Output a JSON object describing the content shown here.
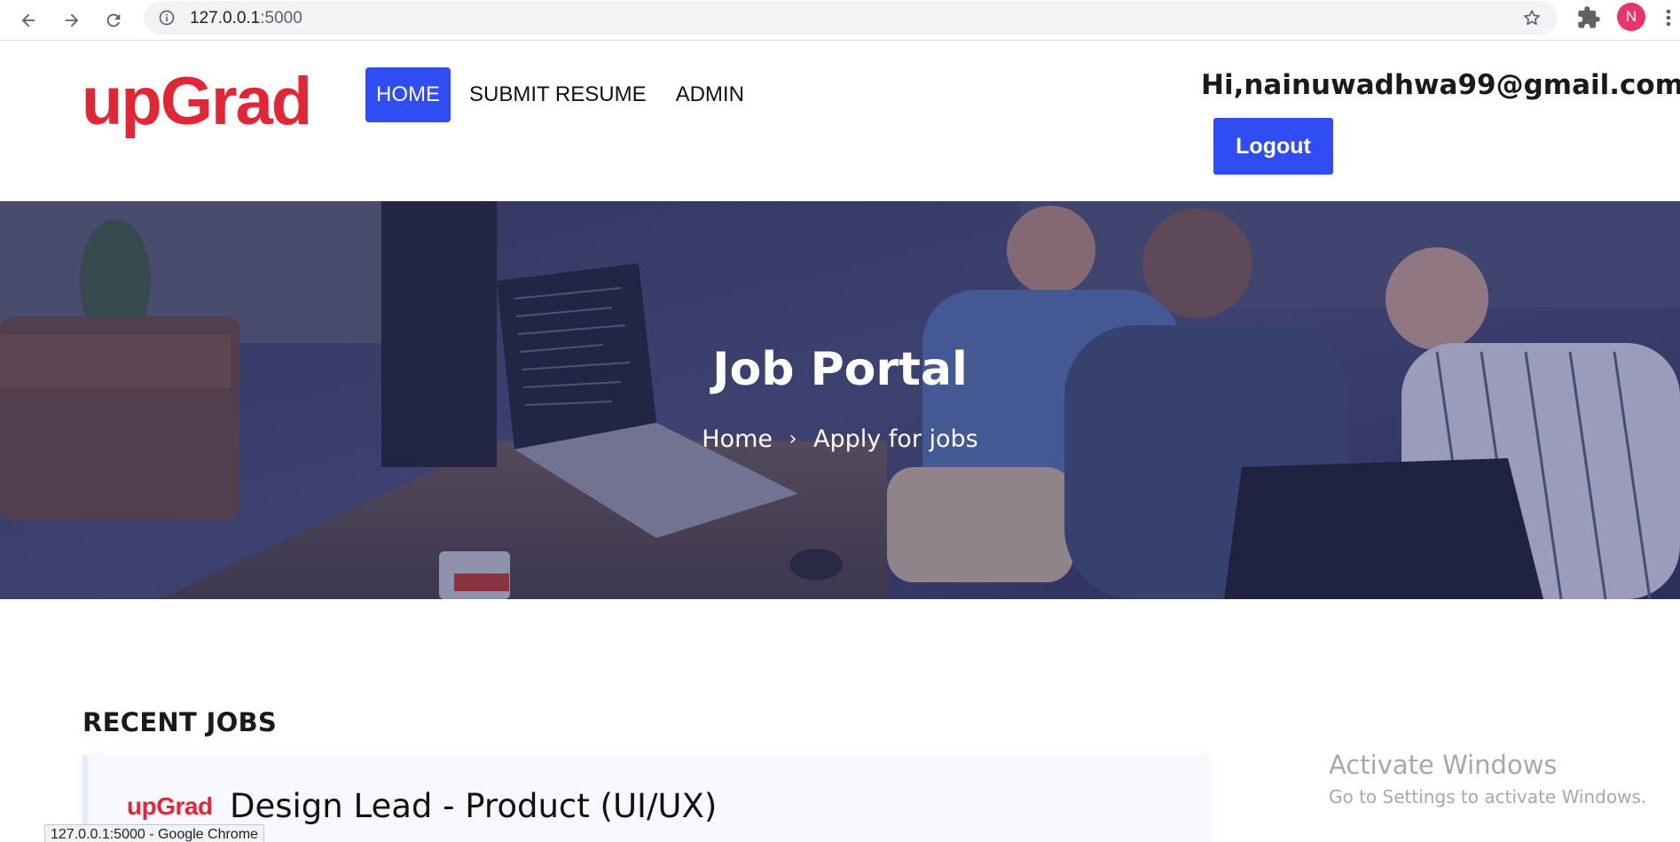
{
  "browser": {
    "url_host": "127.0.0.1",
    "url_port": ":5000",
    "profile_initial": "N",
    "status_bar": "127.0.0.1:5000 - Google Chrome"
  },
  "header": {
    "logo": "upGrad",
    "nav": [
      {
        "label": "HOME",
        "active": true
      },
      {
        "label": "SUBMIT RESUME",
        "active": false
      },
      {
        "label": "ADMIN",
        "active": false
      }
    ],
    "greeting": "Hi,nainuwadhwa99@gmail.com",
    "logout_label": "Logout"
  },
  "hero": {
    "title": "Job Portal",
    "breadcrumb_home": "Home",
    "breadcrumb_sep": "›",
    "breadcrumb_current": "Apply for jobs"
  },
  "jobs": {
    "section_title": "RECENT JOBS",
    "items": [
      {
        "company_logo": "upGrad",
        "title": "Design Lead - Product (UI/UX)"
      }
    ]
  },
  "watermark": {
    "title": "Activate Windows",
    "subtitle": "Go to Settings to activate Windows."
  },
  "colors": {
    "brand_red": "#e32636",
    "primary_blue": "#2f4df3",
    "profile_pink": "#e8336d"
  }
}
